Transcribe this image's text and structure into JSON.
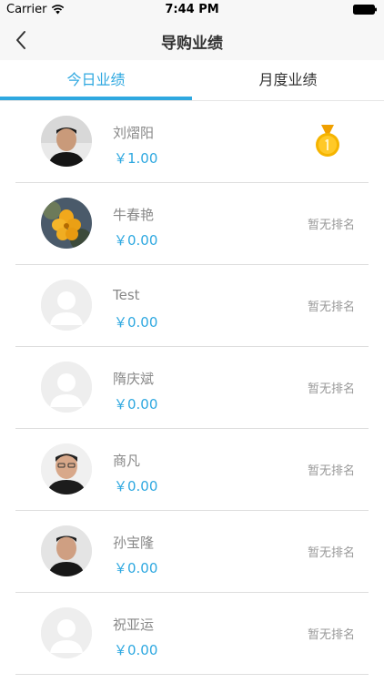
{
  "status_bar": {
    "carrier": "Carrier",
    "time": "7:44 PM"
  },
  "nav": {
    "title": "导购业绩"
  },
  "tabs": [
    {
      "label": "今日业绩",
      "active": true
    },
    {
      "label": "月度业绩",
      "active": false
    }
  ],
  "colors": {
    "accent": "#2ea8e0",
    "medal": "#f5b400"
  },
  "rows": [
    {
      "name": "刘熠阳",
      "amount": "￥1.00",
      "rank": "",
      "avatar": "photo-man-1",
      "medal": true
    },
    {
      "name": "牛春艳",
      "amount": "￥0.00",
      "rank": "暂无排名",
      "avatar": "photo-flower",
      "medal": false
    },
    {
      "name": "Test",
      "amount": "￥0.00",
      "rank": "暂无排名",
      "avatar": "placeholder",
      "medal": false
    },
    {
      "name": "隋庆斌",
      "amount": "￥0.00",
      "rank": "暂无排名",
      "avatar": "placeholder",
      "medal": false
    },
    {
      "name": "商凡",
      "amount": "￥0.00",
      "rank": "暂无排名",
      "avatar": "photo-man-2",
      "medal": false
    },
    {
      "name": "孙宝隆",
      "amount": "￥0.00",
      "rank": "暂无排名",
      "avatar": "photo-man-3",
      "medal": false
    },
    {
      "name": "祝亚运",
      "amount": "￥0.00",
      "rank": "暂无排名",
      "avatar": "placeholder",
      "medal": false
    }
  ]
}
